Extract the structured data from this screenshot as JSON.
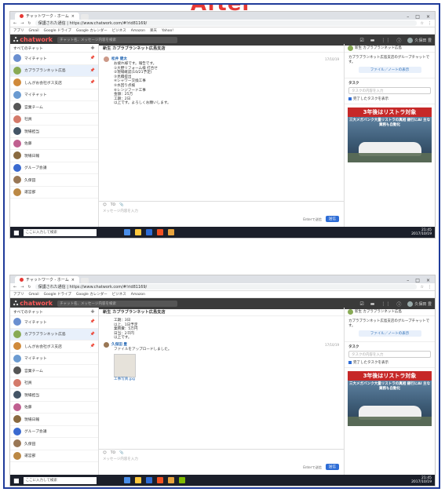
{
  "heading": "After",
  "browser": {
    "tab_title": "チャットワーク - ホーム",
    "address": "保護された通信 | https://www.chatwork.com/#!rid81169/",
    "bookmarks": [
      "アプリ",
      "Gmail",
      "Google ドライブ",
      "Google カレンダー",
      "ビジネス",
      "Amazon",
      "楽天",
      "Yahoo!"
    ]
  },
  "cw_header": {
    "logo": "chatwork",
    "search_placeholder": "チャット名、メッセージ内容を検索",
    "user_name": "久保田 豊"
  },
  "sidebar": {
    "filter_label": "すべてのチャット",
    "items": [
      {
        "label": "マイチャット",
        "color": "#6a8fd0"
      },
      {
        "label": "カプラブランネット広島",
        "color": "#88aa55"
      },
      {
        "label": "しんがお会社ボス支店",
        "color": "#d08a3a"
      },
      {
        "label": "マイチャット",
        "color": "#6b9bd1"
      },
      {
        "label": "営業チーム",
        "color": "#555555"
      },
      {
        "label": "社員",
        "color": "#d47a6a"
      },
      {
        "label": "現場担当",
        "color": "#445566"
      },
      {
        "label": "佐藤",
        "color": "#c06090"
      },
      {
        "label": "現場日報",
        "color": "#8a6a40"
      },
      {
        "label": "グループ会議",
        "color": "#3a6ad0"
      },
      {
        "label": "久保田",
        "color": "#997755"
      },
      {
        "label": "運営部",
        "color": "#bb8844"
      },
      {
        "label": "プロジェクト",
        "color": "#6688aa"
      }
    ]
  },
  "chat_top": {
    "room_title": "新生 カプラブランネット広島支店",
    "author": "松井 健太",
    "time": "17/10/19",
    "lines": [
      "お疲れ様です。報告です。",
      "①大野リフォーム様 打合せ",
      "②現場確認(10/21予定)",
      "③見積提出",
      "④シャワー交換工事",
      "⑤水回り点検",
      "⑥レンジフード工事",
      "金額：25万",
      "工期：2日",
      "以上です。よろしくお願いします。"
    ]
  },
  "chat_bottom": {
    "author": "久保田 豊",
    "time": "17/10/19",
    "upload_text": "ファイルをアップロードしました。",
    "caption": "工事写真.jpg",
    "lines": [
      "工期：3日",
      "以上、1日予定",
      "業務費：5万円",
      "日当：2千円",
      "以上です。"
    ]
  },
  "composer": {
    "placeholder": "メッセージ内容を入力",
    "enter_label": "Enterで送信",
    "send_label": "送信"
  },
  "rpanel": {
    "room_name": "新生 カプラブランネット広島",
    "desc": "カプラブランネット広島支店のグループチャットです。",
    "files_button": "ファイル／ノートの表示",
    "tasks_label": "タスク",
    "task_placeholder": "タスクの内容を入力",
    "task_check": "完了したタスクを表示"
  },
  "ad": {
    "title": "3年後はリストラ対象",
    "sub": "三大メガバンク大量リストラの真相 銀行にAI 主な業務も自動化"
  },
  "taskbar": {
    "search": "ここに入力して検索",
    "time": "21:45",
    "date": "2017/10/19"
  }
}
